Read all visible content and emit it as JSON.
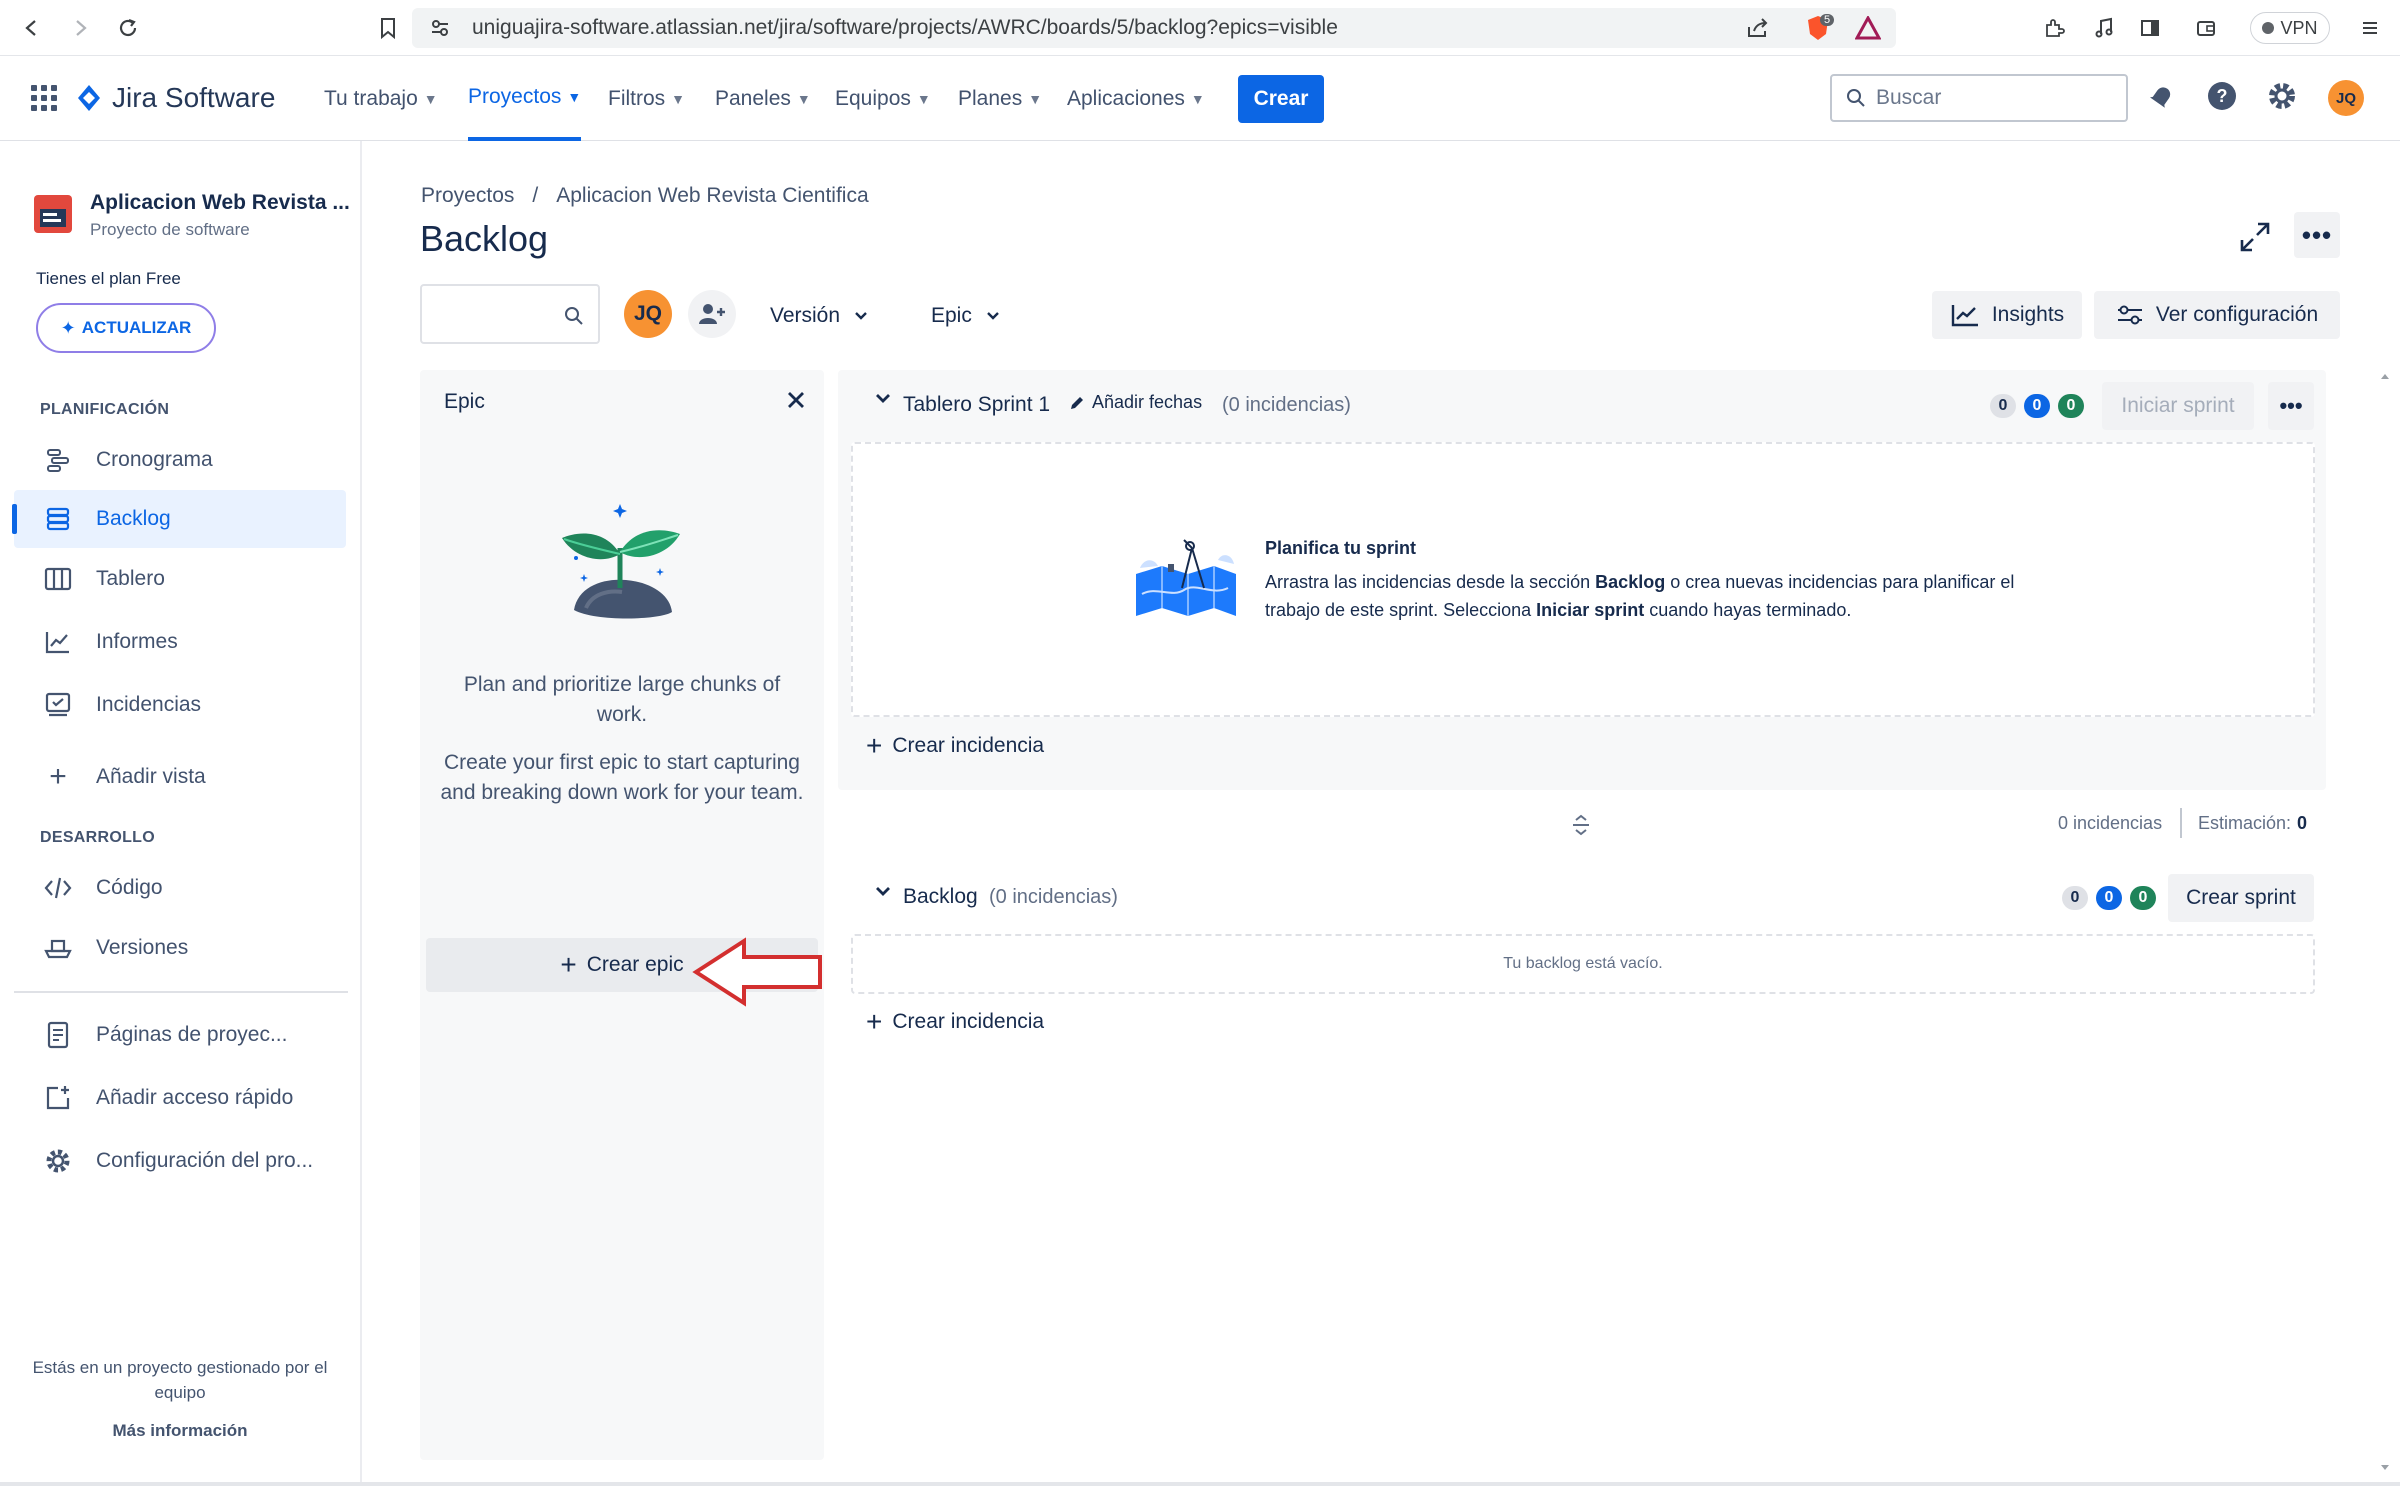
{
  "browser": {
    "url": "uniguajira-software.atlassian.net/jira/software/projects/AWRC/boards/5/backlog?epics=visible",
    "vpn_label": "VPN",
    "brave_badge": "5"
  },
  "topnav": {
    "product": "Jira Software",
    "items": [
      {
        "label": "Tu trabajo"
      },
      {
        "label": "Proyectos"
      },
      {
        "label": "Filtros"
      },
      {
        "label": "Paneles"
      },
      {
        "label": "Equipos"
      },
      {
        "label": "Planes"
      },
      {
        "label": "Aplicaciones"
      }
    ],
    "create_label": "Crear",
    "search_placeholder": "Buscar",
    "user_initials": "JQ"
  },
  "sidebar": {
    "project_name": "Aplicacion Web Revista ...",
    "project_type": "Proyecto de software",
    "plan_text": "Tienes el plan Free",
    "upgrade_label": "ACTUALIZAR",
    "planning_section": "PLANIFICACIÓN",
    "planning_items": [
      {
        "label": "Cronograma",
        "icon": "timeline-icon"
      },
      {
        "label": "Backlog",
        "icon": "backlog-icon"
      },
      {
        "label": "Tablero",
        "icon": "board-icon"
      },
      {
        "label": "Informes",
        "icon": "reports-icon"
      },
      {
        "label": "Incidencias",
        "icon": "issues-icon"
      }
    ],
    "add_view": "Añadir vista",
    "dev_section": "DESARROLLO",
    "dev_items": [
      {
        "label": "Código",
        "icon": "code-icon"
      },
      {
        "label": "Versiones",
        "icon": "releases-icon"
      }
    ],
    "bottom_items": [
      {
        "label": "Páginas de proyec...",
        "icon": "pages-icon"
      },
      {
        "label": "Añadir acceso rápido",
        "icon": "shortcut-icon"
      },
      {
        "label": "Configuración del pro...",
        "icon": "settings-icon"
      }
    ],
    "footer_text": "Estás en un proyecto gestionado por el equipo",
    "footer_link": "Más información"
  },
  "main": {
    "breadcrumb": {
      "root": "Proyectos",
      "sep": "/",
      "project": "Aplicacion Web Revista Cientifica"
    },
    "title": "Backlog",
    "filters": {
      "avatar": "JQ",
      "version": "Versión",
      "epic": "Epic"
    },
    "insights_label": "Insights",
    "config_label": "Ver configuración"
  },
  "epic_panel": {
    "title": "Epic",
    "text1": "Plan and prioritize large chunks of work.",
    "text2": "Create your first epic to start capturing and breaking down work for your team.",
    "create_label": "Crear epic"
  },
  "sprint": {
    "name": "Tablero Sprint 1",
    "add_dates": "Añadir fechas",
    "count": "(0 incidencias)",
    "badges": [
      "0",
      "0",
      "0"
    ],
    "start_label": "Iniciar sprint",
    "plan_title": "Planifica tu sprint",
    "plan_text_1": "Arrastra las incidencias desde la sección ",
    "plan_bold_1": "Backlog",
    "plan_text_2": " o crea nuevas incidencias para planificar el trabajo de este sprint. Selecciona ",
    "plan_bold_2": "Iniciar sprint",
    "plan_text_3": " cuando hayas terminado.",
    "create_issue": "Crear incidencia"
  },
  "summary": {
    "issues": "0 incidencias",
    "estimate_label": "Estimación:",
    "estimate_value": "0"
  },
  "backlog": {
    "name": "Backlog",
    "count": "(0 incidencias)",
    "badges": [
      "0",
      "0",
      "0"
    ],
    "create_sprint": "Crear sprint",
    "empty_text": "Tu backlog está vacío.",
    "create_issue": "Crear incidencia"
  },
  "colors": {
    "accent": "#0c66e4",
    "annotation_arrow": "#d32f2f",
    "avatar": "#f79232"
  }
}
